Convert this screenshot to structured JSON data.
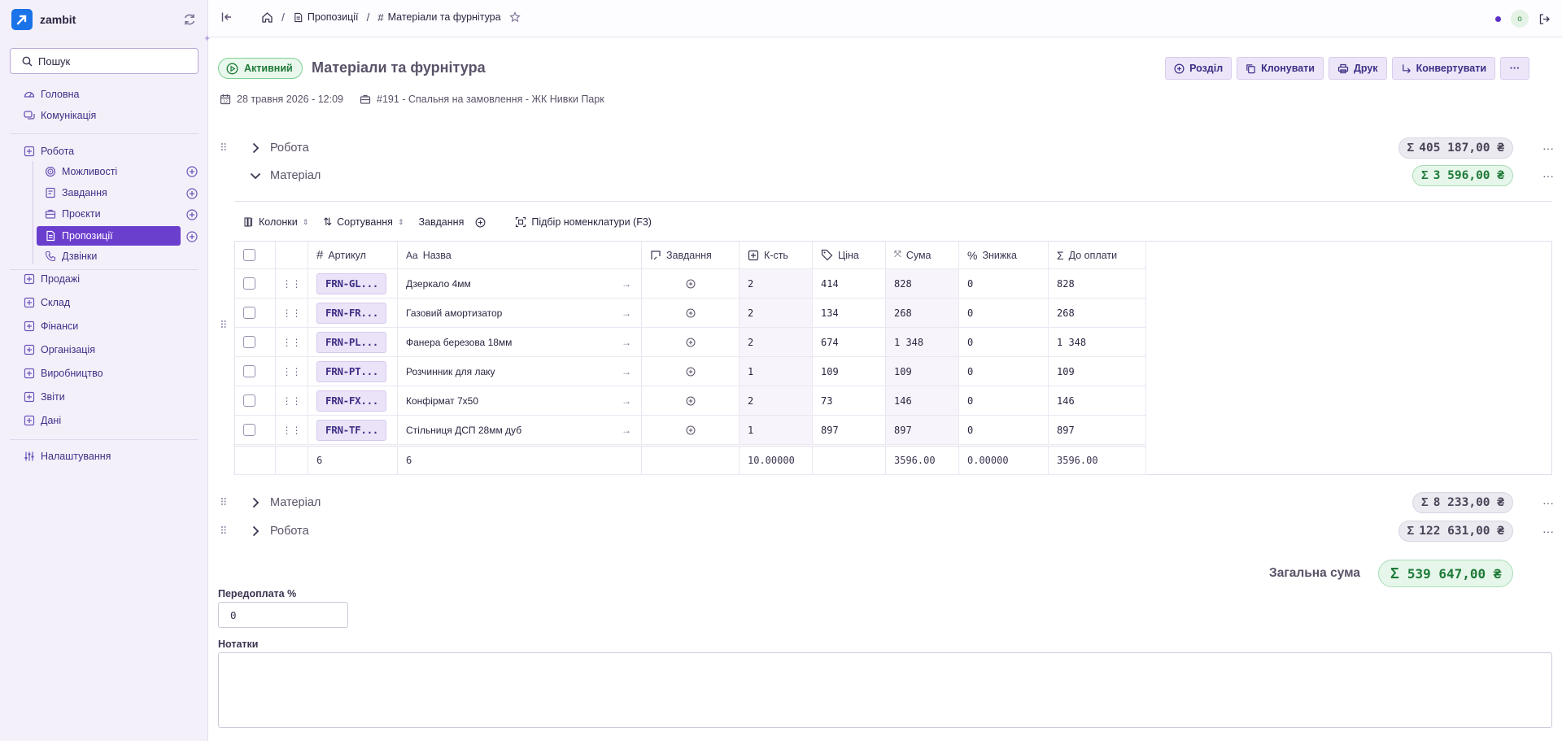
{
  "app": {
    "name": "zambit"
  },
  "sidebar": {
    "search_placeholder": "Пошук",
    "items": [
      {
        "label": "Головна",
        "icon": "dashboard-icon"
      },
      {
        "label": "Комунікація",
        "icon": "chat-icon"
      },
      {
        "label": "Робота",
        "icon": "plus-square-icon"
      },
      {
        "label": "Можливості",
        "icon": "target-icon"
      },
      {
        "label": "Завдання",
        "icon": "task-icon"
      },
      {
        "label": "Проєкти",
        "icon": "briefcase-icon"
      },
      {
        "label": "Пропозиції",
        "icon": "document-icon"
      },
      {
        "label": "Дзвінки",
        "icon": "phone-icon"
      },
      {
        "label": "Продажі",
        "icon": "plus-square-icon"
      },
      {
        "label": "Склад",
        "icon": "plus-square-icon"
      },
      {
        "label": "Фінанси",
        "icon": "plus-square-icon"
      },
      {
        "label": "Організація",
        "icon": "plus-square-icon"
      },
      {
        "label": "Виробництво",
        "icon": "plus-square-icon"
      },
      {
        "label": "Звіти",
        "icon": "plus-square-icon"
      },
      {
        "label": "Дані",
        "icon": "plus-square-icon"
      },
      {
        "label": "Налаштування",
        "icon": "sliders-icon"
      }
    ]
  },
  "topbar": {
    "breadcrumbs": [
      "Пропозиції",
      "Матеріали та фурнітура"
    ],
    "user_initial": "о"
  },
  "header": {
    "status": "Активний",
    "title": "Матеріали та фурнітура",
    "actions": [
      "Розділ",
      "Клонувати",
      "Друк",
      "Конвертувати"
    ],
    "date": "28 травня 2026 - 12:09",
    "project": "#191 - Спальня на замовлення - ЖК Нивки Парк"
  },
  "sections": [
    {
      "title": "Робота",
      "sum": "405 187,00 ₴",
      "expanded": false
    },
    {
      "title": "Матеріал",
      "sum": "3 596,00 ₴",
      "expanded": true
    },
    {
      "title": "Матеріал",
      "sum": "8 233,00 ₴",
      "expanded": false
    },
    {
      "title": "Робота",
      "sum": "122 631,00 ₴",
      "expanded": false
    }
  ],
  "toolbar": {
    "columns": "Колонки",
    "sort": "Сортування",
    "tasks": "Завдання",
    "pick": "Підбір номенклатури (F3)"
  },
  "table": {
    "headers": [
      "Артикул",
      "Назва",
      "Завдання",
      "К-сть",
      "Ціна",
      "Сума",
      "Знижка",
      "До оплати"
    ],
    "rows": [
      {
        "sku": "FRN-GL...",
        "name": "Дзеркало 4мм",
        "qty": "2",
        "price": "414",
        "sum": "828",
        "discount": "0",
        "total": "828"
      },
      {
        "sku": "FRN-FR...",
        "name": "Газовий амортизатор",
        "qty": "2",
        "price": "134",
        "sum": "268",
        "discount": "0",
        "total": "268"
      },
      {
        "sku": "FRN-PL...",
        "name": "Фанера березова 18мм",
        "qty": "2",
        "price": "674",
        "sum": "1 348",
        "discount": "0",
        "total": "1 348"
      },
      {
        "sku": "FRN-PT...",
        "name": "Розчинник для лаку",
        "qty": "1",
        "price": "109",
        "sum": "109",
        "discount": "0",
        "total": "109"
      },
      {
        "sku": "FRN-FX...",
        "name": "Конфірмат 7x50",
        "qty": "2",
        "price": "73",
        "sum": "146",
        "discount": "0",
        "total": "146"
      },
      {
        "sku": "FRN-TF...",
        "name": "Стільниця ДСП 28мм дуб",
        "qty": "1",
        "price": "897",
        "sum": "897",
        "discount": "0",
        "total": "897"
      }
    ],
    "footer": {
      "sku_count": "6",
      "name_count": "6",
      "qty": "10.00000",
      "sum": "3596.00",
      "discount": "0.00000",
      "total": "3596.00"
    }
  },
  "totals": {
    "label": "Загальна сума",
    "value": "539 647,00 ₴"
  },
  "prepayment": {
    "label": "Передоплата %",
    "value": "0"
  },
  "notes": {
    "label": "Нотатки",
    "value": ""
  },
  "colors": {
    "accent": "#6b3fce",
    "status_green": "#1e7a38"
  }
}
